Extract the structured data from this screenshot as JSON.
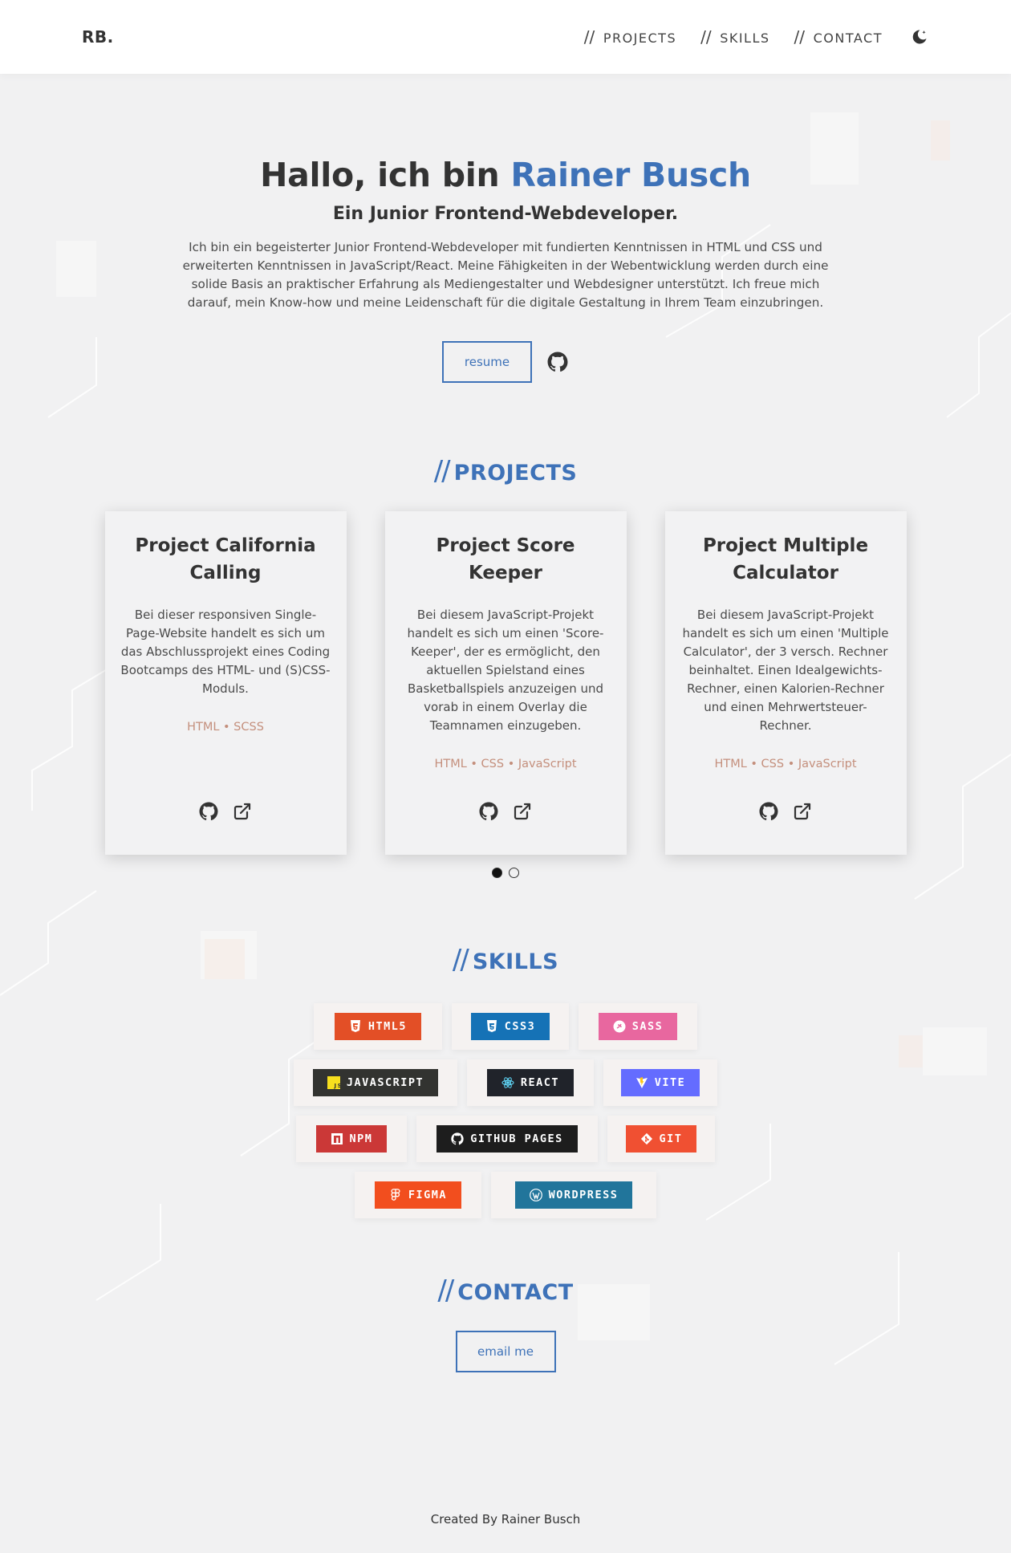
{
  "header": {
    "logo": "RB.",
    "nav": [
      {
        "slashes": "//",
        "label": "PROJECTS"
      },
      {
        "slashes": "//",
        "label": "SKILLS"
      },
      {
        "slashes": "//",
        "label": "CONTACT"
      }
    ],
    "theme_icon": "moon-star-icon"
  },
  "hero": {
    "greeting": "Hallo, ich bin ",
    "name": "Rainer Busch",
    "subtitle": "Ein Junior Frontend-Webdeveloper.",
    "intro": "Ich bin ein begeisterter Junior Frontend-Webdeveloper mit fundierten Kenntnissen in HTML und CSS und erweiterten Kenntnissen in JavaScript/React. Meine Fähigkeiten in der Webentwicklung werden durch eine solide Basis an praktischer Erfahrung als Mediengestalter und Webdesigner unterstützt. Ich freue mich darauf, mein Know-how und meine Leidenschaft für die digitale Gestaltung in Ihrem Team einzubringen.",
    "resume_label": "resume",
    "github_icon": "github-icon"
  },
  "projects": {
    "slashes": "//",
    "title": "PROJECTS",
    "cards": [
      {
        "title": "Project California Calling",
        "description": "Bei dieser responsiven Single-Page-Website handelt es sich um das Abschlussprojekt eines Coding Bootcamps des HTML- und (S)CSS-Moduls.",
        "tags": "HTML • SCSS"
      },
      {
        "title": "Project Score Keeper",
        "description": "Bei diesem JavaScript-Projekt handelt es sich um einen 'Score-Keeper', der es ermöglicht, den aktuellen Spielstand eines Basketballspiels anzuzeigen und vorab in einem Overlay die Teamnamen einzugeben.",
        "tags": "HTML • CSS • JavaScript"
      },
      {
        "title": "Project Multiple Calculator",
        "description": "Bei diesem JavaScript-Projekt handelt es sich um einen 'Multiple Calculator', der 3 versch. Rechner beinhaltet. Einen Idealgewichts-Rechner, einen Kalorien-Rechner und einen Mehrwertsteuer-Rechner.",
        "tags": "HTML • CSS • JavaScript"
      }
    ],
    "pagination": {
      "current": 1,
      "total": 2
    }
  },
  "skills": {
    "slashes": "//",
    "title": "SKILLS",
    "rows": [
      [
        {
          "label": "HTML5",
          "color": "#e34f26",
          "icon": "html5-icon"
        },
        {
          "label": "CSS3",
          "color": "#1572b6",
          "icon": "css3-icon"
        },
        {
          "label": "SASS",
          "color": "#e8679f",
          "icon": "sass-icon"
        }
      ],
      [
        {
          "label": "JAVASCRIPT",
          "color": "#323330",
          "icon": "javascript-icon"
        },
        {
          "label": "REACT",
          "color": "#20232a",
          "icon": "react-icon"
        },
        {
          "label": "VITE",
          "color": "#646cff",
          "icon": "vite-icon"
        }
      ],
      [
        {
          "label": "NPM",
          "color": "#cb3837",
          "icon": "npm-icon"
        },
        {
          "label": "GITHUB PAGES",
          "color": "#1d1d1d",
          "icon": "github-icon"
        },
        {
          "label": "GIT",
          "color": "#f05032",
          "icon": "git-icon"
        }
      ],
      [
        {
          "label": "FIGMA",
          "color": "#f24e1e",
          "icon": "figma-icon"
        },
        {
          "label": "WORDPRESS",
          "color": "#21759b",
          "icon": "wordpress-icon"
        }
      ]
    ]
  },
  "contact": {
    "slashes": "//",
    "title": "CONTACT",
    "email_label": "email me"
  },
  "footer": {
    "text": "Created By Rainer Busch"
  }
}
